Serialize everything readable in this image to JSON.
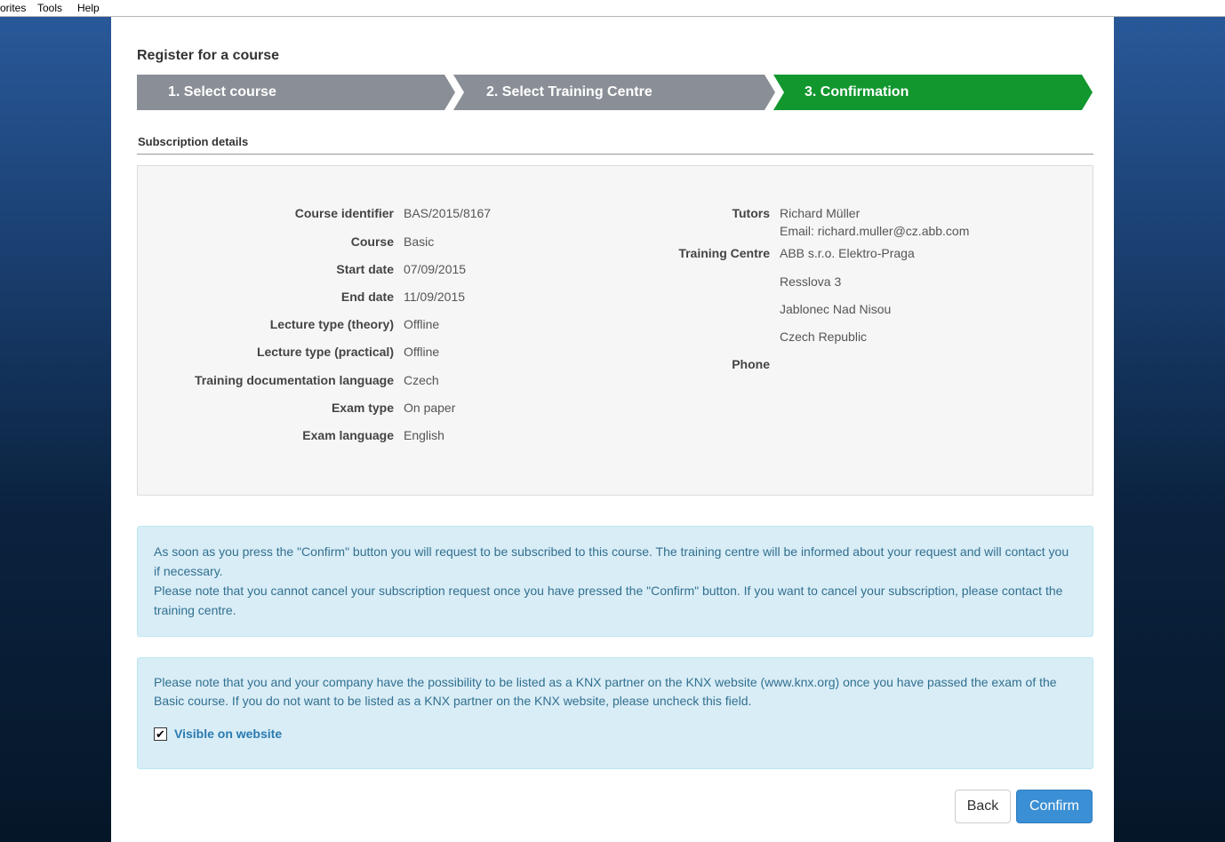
{
  "menu": {
    "items": [
      "orites",
      "Tools",
      "Help"
    ]
  },
  "page": {
    "title": "Register for a course"
  },
  "steps": [
    {
      "label": "1. Select course",
      "state": "done"
    },
    {
      "label": "2. Select Training Centre",
      "state": "done"
    },
    {
      "label": "3. Confirmation",
      "state": "active"
    }
  ],
  "colors": {
    "step_inactive": "#8a8f97",
    "step_active": "#12972f",
    "alert_bg": "#d9edf7",
    "alert_text": "#31708f",
    "primary": "#3b8fd4"
  },
  "subscription": {
    "heading": "Subscription details",
    "left": [
      {
        "label": "Course identifier",
        "value": "BAS/2015/8167"
      },
      {
        "label": "Course",
        "value": "Basic"
      },
      {
        "label": "Start date",
        "value": "07/09/2015"
      },
      {
        "label": "End date",
        "value": "11/09/2015"
      },
      {
        "label": "Lecture type (theory)",
        "value": "Offline"
      },
      {
        "label": "Lecture type (practical)",
        "value": "Offline"
      },
      {
        "label": "Training documentation language",
        "value": "Czech"
      },
      {
        "label": "Exam type",
        "value": "On paper"
      },
      {
        "label": "Exam language",
        "value": "English"
      }
    ],
    "tutors": {
      "label": "Tutors",
      "name": "Richard Müller",
      "email": "Email: richard.muller@cz.abb.com"
    },
    "training_centre": {
      "label": "Training Centre",
      "lines": [
        "ABB s.r.o. Elektro-Praga",
        "Resslova 3",
        "Jablonec Nad Nisou",
        "Czech Republic"
      ]
    },
    "phone": {
      "label": "Phone",
      "value": ""
    }
  },
  "alerts": {
    "confirm_info_1": "As soon as you press the \"Confirm\" button you will request to be subscribed to this course. The training centre will be informed about your request and will contact you if necessary.",
    "confirm_info_2": "Please note that you cannot cancel your subscription request once you have pressed the \"Confirm\" button. If you want to cancel your subscription, please contact the training centre.",
    "knx_info": "Please note that you and your company have the possibility to be listed as a KNX partner on the KNX website (www.knx.org) once you have passed the exam of the Basic course. If you do not want to be listed as a KNX partner on the KNX website, please uncheck this field.",
    "visible_checkbox": {
      "label": "Visible on website",
      "checked": true
    }
  },
  "buttons": {
    "back": "Back",
    "confirm": "Confirm"
  }
}
